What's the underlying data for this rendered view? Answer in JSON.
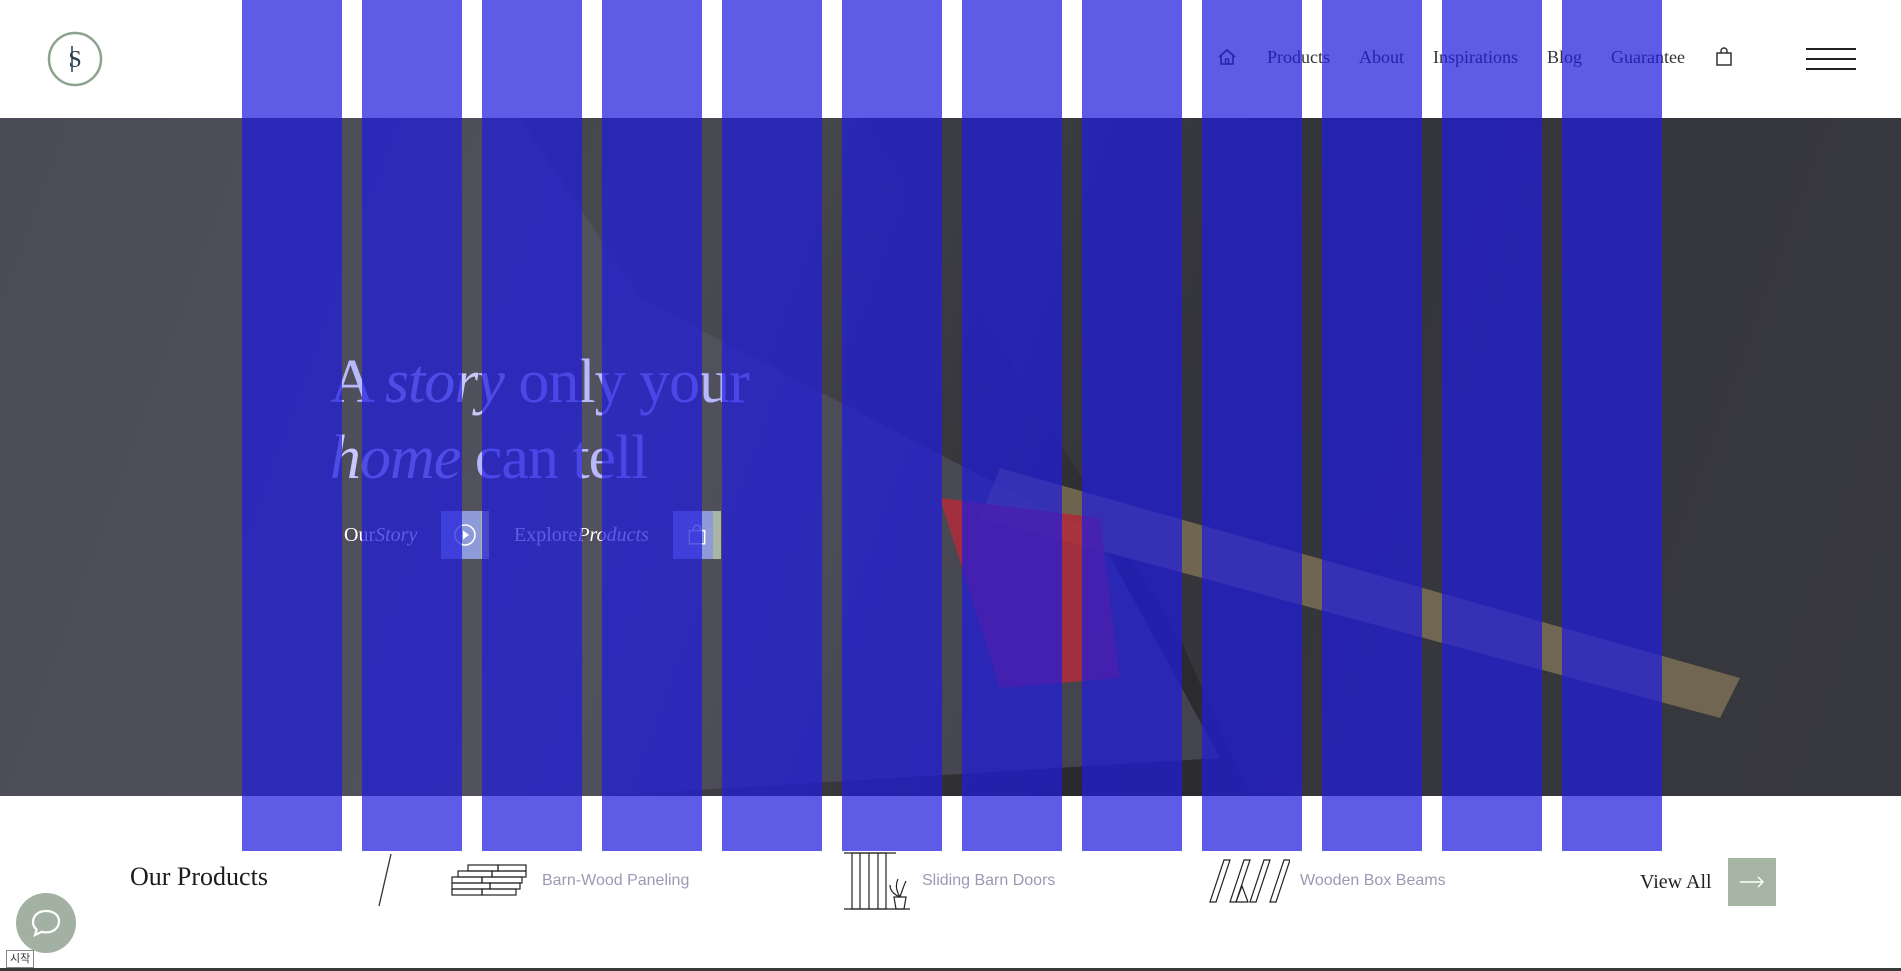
{
  "header": {
    "nav": [
      {
        "label": "Products"
      },
      {
        "label": "About"
      },
      {
        "label": "Inspirations"
      },
      {
        "label": "Blog"
      },
      {
        "label": "Guarantee"
      }
    ]
  },
  "hero": {
    "title_line1_a": "A ",
    "title_line1_b": "story",
    "title_line1_c": " only your",
    "title_line2_a": "home",
    "title_line2_b": " can tell",
    "cta1_a": "Our ",
    "cta1_b": "Story",
    "cta2_a": "Explore ",
    "cta2_b": "Products"
  },
  "products": {
    "title": "Our Products",
    "items": [
      {
        "label": "Barn-Wood Paneling",
        "icon": "paneling-icon"
      },
      {
        "label": "Sliding Barn Doors",
        "icon": "barn-door-icon"
      },
      {
        "label": "Wooden Box Beams",
        "icon": "box-beams-icon"
      }
    ],
    "view_all": "View All"
  },
  "misc": {
    "start_tag": "시작"
  },
  "colors": {
    "accent_green": "#a7b6a4",
    "overlay_blue": "#201cdc"
  }
}
